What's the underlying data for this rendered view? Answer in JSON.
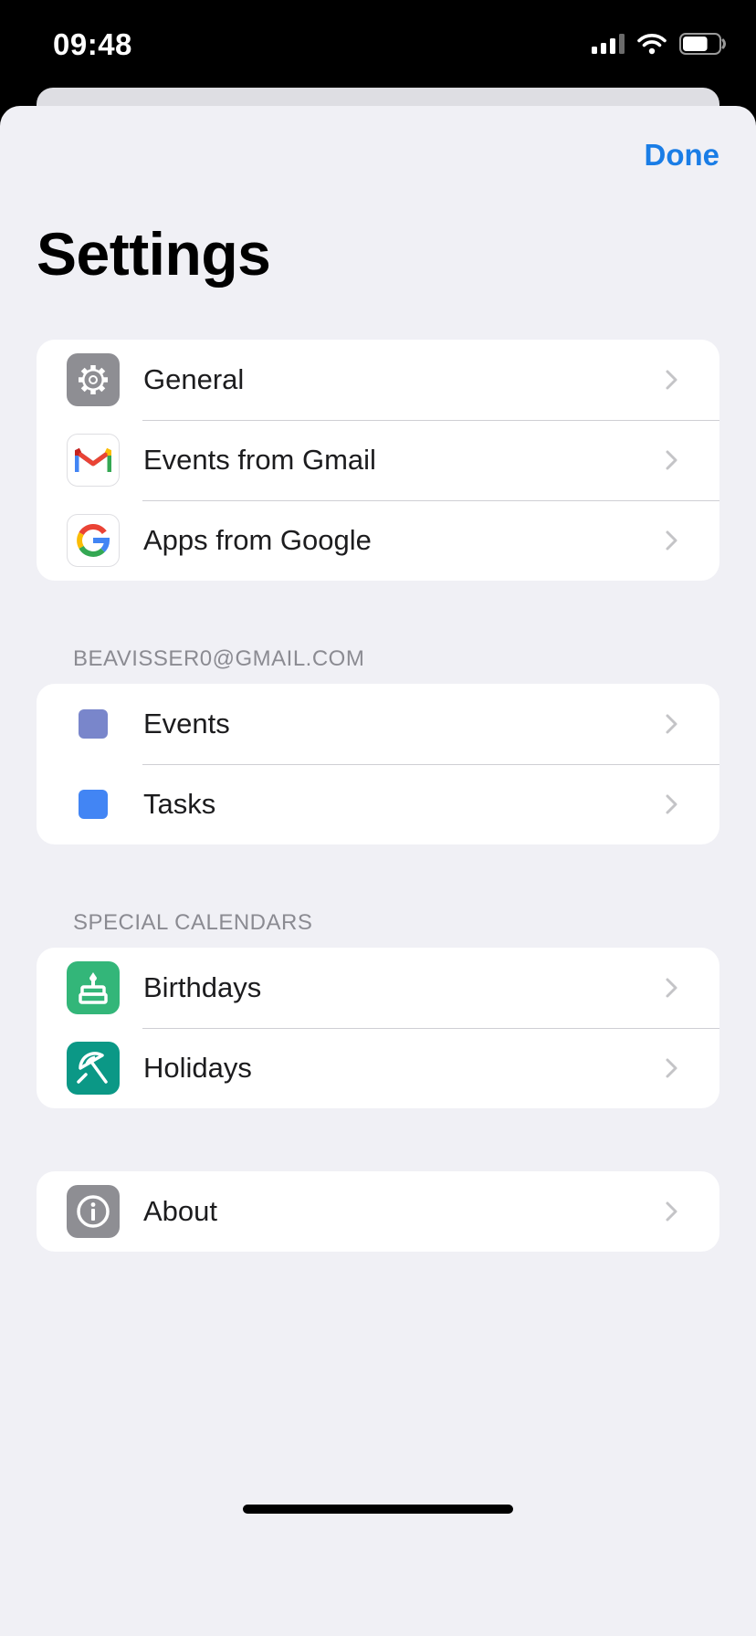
{
  "status_bar": {
    "time": "09:48",
    "battery_level": 0.7
  },
  "header": {
    "done_label": "Done",
    "title": "Settings"
  },
  "groups": {
    "main": {
      "items": [
        {
          "label": "General",
          "icon": "gear-icon"
        },
        {
          "label": "Events from Gmail",
          "icon": "gmail-icon"
        },
        {
          "label": "Apps from Google",
          "icon": "google-icon"
        }
      ]
    },
    "account": {
      "header": "BEAVISSER0@GMAIL.COM",
      "items": [
        {
          "label": "Events",
          "color": "#7986cb"
        },
        {
          "label": "Tasks",
          "color": "#4285f4"
        }
      ]
    },
    "special": {
      "header": "SPECIAL CALENDARS",
      "items": [
        {
          "label": "Birthdays",
          "icon": "cake-icon",
          "color": "#33b679"
        },
        {
          "label": "Holidays",
          "icon": "umbrella-icon",
          "color": "#0b9886"
        }
      ]
    },
    "about": {
      "items": [
        {
          "label": "About",
          "icon": "info-icon"
        }
      ]
    }
  },
  "colors": {
    "accent": "#1a7de6",
    "background": "#f0f0f5",
    "icon_gray": "#8e8e93"
  }
}
